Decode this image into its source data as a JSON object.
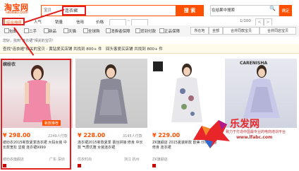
{
  "header": {
    "logo": "淘宝网",
    "logo_sub": "Taobao.com",
    "search_scope": "宝贝",
    "search_query": "连衣裙",
    "search_button": "搜 索",
    "in_result_label": "在结果中搜索",
    "in_result_button": "确定"
  },
  "tabs": [
    "综合排序",
    "人气",
    "销量",
    "信用",
    "价格"
  ],
  "filters": {
    "hide_missing": "包邮",
    "second_hand": "二手",
    "new": "新品",
    "tmall": "天猫",
    "global": "全球购",
    "consumer": "消费者保障",
    "cod": "货到付款",
    "invoice": "正品保障",
    "price_to": "~",
    "region": "所在地",
    "view_all": "全部",
    "same_style": "合并同款宝贝",
    "same_shop": "合并同店宝贝",
    "pages": "1/100"
  },
  "notice": "您好，找到\"连衣裙\"相关的宝贝！",
  "subnotice": {
    "left": "查找\"连衣裙\"相关的宝贝 · 黄钻爱买店铺 共找到 800+ 件",
    "right": "回头客爱买店铺 共找到 800+ 件"
  },
  "products": [
    {
      "brand_tag": "缤纷衣",
      "price": "¥ 298.00",
      "sales": "2249人付款",
      "title": "缤纷衣2015新款夏季连衣裙 大码女装 中长款宽松 显瘦 连衣裙9999",
      "shop": "缤纷衣旗舰店",
      "location": "广东 深圳",
      "corner_tag": "新款推荐"
    },
    {
      "brand_tag": "",
      "price": "¥ 228.00",
      "sales": "3145人付款",
      "title": "连衣裙2015新款夏季 蕾丝拼接 修身 中长款 气质优雅 女装连衣裙",
      "shop": "优衣时尚",
      "location": "浙江 杭州"
    },
    {
      "brand_tag": "",
      "price": "¥ 229.00",
      "sales": "",
      "title": "ZK旗舰店 2015夏装新款 欧美 印花 无袖 修身 连衣裙",
      "shop": "ZK旗舰店",
      "location": ""
    },
    {
      "brand_tag": "CARENISHA",
      "price": "",
      "sales": "",
      "title": "",
      "shop": "",
      "location": ""
    }
  ],
  "watermark": {
    "title": "乐发网",
    "sub": "致力于打造中国最专业的电商培训平台",
    "url": "www.lfabc.com"
  },
  "colors": {
    "accent": "#ff5000",
    "annotation": "#e02020",
    "price": "#ff5000"
  }
}
